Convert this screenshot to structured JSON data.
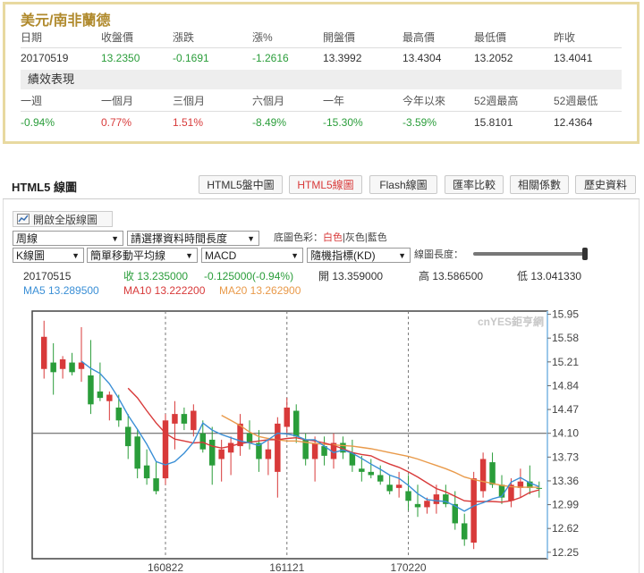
{
  "quote": {
    "title": "美元/南非蘭德",
    "headers": [
      "日期",
      "收盤價",
      "漲跌",
      "漲%",
      "開盤價",
      "最高價",
      "最低價",
      "昨收"
    ],
    "values": [
      "20170519",
      "13.2350",
      "-0.1691",
      "-1.2616",
      "13.3992",
      "13.4304",
      "13.2052",
      "13.4041"
    ],
    "perf_title": "績效表現",
    "perf_headers": [
      "一週",
      "一個月",
      "三個月",
      "六個月",
      "一年",
      "今年以來",
      "52週最高",
      "52週最低"
    ],
    "perf_values": [
      "-0.94%",
      "0.77%",
      "1.51%",
      "-8.49%",
      "-15.30%",
      "-3.59%",
      "15.8101",
      "12.4364"
    ]
  },
  "chart_panel": {
    "title": "HTML5 線圖",
    "tabs": [
      "HTML5盤中圖",
      "HTML5線圖",
      "Flash線圖",
      "匯率比較",
      "相關係數",
      "歷史資料"
    ],
    "active_tab": "HTML5線圖",
    "fullscreen_label": "開啟全版線圖",
    "period_select": "周線",
    "range_select": "請選擇資料時間長度",
    "bg_label": "底圖色彩：",
    "bg_white": "白色",
    "bg_sep1": "|",
    "bg_gray": "灰色",
    "bg_sep2": "|",
    "bg_blue": "藍色",
    "kline_select": "K線圖",
    "ma_select": "簡單移動平均線",
    "indicator_select": "MACD",
    "kd_select": "隨機指標(KD)",
    "length_label": "線圖長度："
  },
  "info": {
    "date": "20170515",
    "close": "收 13.235000",
    "change": "-0.125000(-0.94%)",
    "open": "開 13.359000",
    "high": "高 13.586500",
    "low": "低 13.041330",
    "ma5": "MA5 13.289500",
    "ma10": "MA10 13.222200",
    "ma20": "MA20 13.262900"
  },
  "colors": {
    "up": "#d83a3a",
    "down": "#2a9d3a",
    "ma5": "#3a8fd6",
    "ma10": "#d83a3a",
    "ma20": "#e99a4a",
    "accent": "#b08a2d"
  },
  "chart_data": {
    "type": "candlestick",
    "watermark": "cnYES鉅亨網",
    "ylim": [
      12.15,
      16.0
    ],
    "y_ticks": [
      15.95,
      15.58,
      15.21,
      14.84,
      14.47,
      14.1,
      13.73,
      13.36,
      12.99,
      12.62,
      12.25
    ],
    "y_tick_labels": [
      "15.95",
      "15.58",
      "15.21",
      "14.84",
      "14.47",
      "14.10",
      "13.73",
      "13.36",
      "12.99",
      "12.62",
      "12.25"
    ],
    "x_labels": [
      {
        "index": 13,
        "label": "160822"
      },
      {
        "index": 26,
        "label": "161121"
      },
      {
        "index": 39,
        "label": "170220"
      }
    ],
    "candles": [
      {
        "o": 15.1,
        "h": 15.85,
        "l": 14.95,
        "c": 15.6
      },
      {
        "o": 15.2,
        "h": 15.5,
        "l": 14.7,
        "c": 15.05
      },
      {
        "o": 15.1,
        "h": 15.3,
        "l": 14.95,
        "c": 15.25
      },
      {
        "o": 15.2,
        "h": 15.35,
        "l": 15.0,
        "c": 15.05
      },
      {
        "o": 15.1,
        "h": 15.75,
        "l": 14.9,
        "c": 15.2
      },
      {
        "o": 15.0,
        "h": 15.55,
        "l": 14.4,
        "c": 14.55
      },
      {
        "o": 14.75,
        "h": 15.2,
        "l": 14.6,
        "c": 14.65
      },
      {
        "o": 14.6,
        "h": 14.75,
        "l": 14.3,
        "c": 14.7
      },
      {
        "o": 14.5,
        "h": 14.7,
        "l": 14.2,
        "c": 14.3
      },
      {
        "o": 14.2,
        "h": 14.4,
        "l": 13.7,
        "c": 13.9
      },
      {
        "o": 14.05,
        "h": 14.15,
        "l": 13.4,
        "c": 13.55
      },
      {
        "o": 13.6,
        "h": 13.85,
        "l": 13.3,
        "c": 13.4
      },
      {
        "o": 13.4,
        "h": 13.65,
        "l": 13.15,
        "c": 13.2
      },
      {
        "o": 13.4,
        "h": 14.4,
        "l": 13.3,
        "c": 14.3
      },
      {
        "o": 14.25,
        "h": 14.6,
        "l": 13.85,
        "c": 14.4
      },
      {
        "o": 14.4,
        "h": 14.5,
        "l": 14.15,
        "c": 14.25
      },
      {
        "o": 14.15,
        "h": 14.55,
        "l": 14.05,
        "c": 14.45
      },
      {
        "o": 14.1,
        "h": 14.3,
        "l": 13.8,
        "c": 13.85
      },
      {
        "o": 14.0,
        "h": 14.2,
        "l": 13.3,
        "c": 13.6
      },
      {
        "o": 13.7,
        "h": 14.0,
        "l": 13.35,
        "c": 13.85
      },
      {
        "o": 13.8,
        "h": 14.05,
        "l": 13.45,
        "c": 13.95
      },
      {
        "o": 13.9,
        "h": 14.4,
        "l": 13.75,
        "c": 14.25
      },
      {
        "o": 14.1,
        "h": 14.3,
        "l": 13.85,
        "c": 13.95
      },
      {
        "o": 13.95,
        "h": 14.15,
        "l": 13.5,
        "c": 13.7
      },
      {
        "o": 13.7,
        "h": 14.0,
        "l": 13.45,
        "c": 13.85
      },
      {
        "o": 13.5,
        "h": 14.35,
        "l": 13.1,
        "c": 14.25
      },
      {
        "o": 14.2,
        "h": 14.65,
        "l": 14.1,
        "c": 14.5
      },
      {
        "o": 14.45,
        "h": 14.55,
        "l": 13.95,
        "c": 14.05
      },
      {
        "o": 14.0,
        "h": 14.1,
        "l": 13.6,
        "c": 13.7
      },
      {
        "o": 13.7,
        "h": 14.05,
        "l": 13.35,
        "c": 13.95
      },
      {
        "o": 13.9,
        "h": 14.05,
        "l": 13.6,
        "c": 13.75
      },
      {
        "o": 13.7,
        "h": 14.1,
        "l": 13.55,
        "c": 13.95
      },
      {
        "o": 13.95,
        "h": 14.05,
        "l": 13.7,
        "c": 13.8
      },
      {
        "o": 13.8,
        "h": 14.0,
        "l": 13.5,
        "c": 13.6
      },
      {
        "o": 13.55,
        "h": 13.75,
        "l": 13.35,
        "c": 13.5
      },
      {
        "o": 13.5,
        "h": 13.7,
        "l": 13.4,
        "c": 13.45
      },
      {
        "o": 13.45,
        "h": 13.6,
        "l": 13.3,
        "c": 13.35
      },
      {
        "o": 13.3,
        "h": 13.45,
        "l": 13.15,
        "c": 13.2
      },
      {
        "o": 13.25,
        "h": 13.5,
        "l": 13.1,
        "c": 13.3
      },
      {
        "o": 13.2,
        "h": 13.45,
        "l": 12.9,
        "c": 13.05
      },
      {
        "o": 13.0,
        "h": 13.3,
        "l": 12.8,
        "c": 12.95
      },
      {
        "o": 12.95,
        "h": 13.1,
        "l": 12.85,
        "c": 13.05
      },
      {
        "o": 13.0,
        "h": 13.3,
        "l": 12.85,
        "c": 13.15
      },
      {
        "o": 13.15,
        "h": 13.3,
        "l": 12.95,
        "c": 13.0
      },
      {
        "o": 13.0,
        "h": 13.2,
        "l": 12.6,
        "c": 12.7
      },
      {
        "o": 12.7,
        "h": 12.85,
        "l": 12.35,
        "c": 12.45
      },
      {
        "o": 12.4,
        "h": 13.5,
        "l": 12.3,
        "c": 13.4
      },
      {
        "o": 13.2,
        "h": 13.8,
        "l": 13.1,
        "c": 13.7
      },
      {
        "o": 13.65,
        "h": 13.8,
        "l": 13.25,
        "c": 13.3
      },
      {
        "o": 13.3,
        "h": 13.45,
        "l": 13.0,
        "c": 13.1
      },
      {
        "o": 13.05,
        "h": 13.4,
        "l": 12.95,
        "c": 13.3
      },
      {
        "o": 13.25,
        "h": 13.55,
        "l": 13.1,
        "c": 13.35
      },
      {
        "o": 13.35,
        "h": 13.6,
        "l": 13.15,
        "c": 13.25
      },
      {
        "o": 13.25,
        "h": 13.35,
        "l": 13.1,
        "c": 13.24
      }
    ],
    "ma5": [
      null,
      null,
      null,
      null,
      15.22,
      15.11,
      15.03,
      14.87,
      14.64,
      14.38,
      14.16,
      13.93,
      13.66,
      13.61,
      13.66,
      13.79,
      13.96,
      14.26,
      14.15,
      14.08,
      14.03,
      13.98,
      13.95,
      13.91,
      14.0,
      14.1,
      14.09,
      14.06,
      14.0,
      14.0,
      13.9,
      13.8,
      13.84,
      13.79,
      13.71,
      13.62,
      13.54,
      13.45,
      13.4,
      13.29,
      13.16,
      13.07,
      13.05,
      13.04,
      12.97,
      12.89,
      12.97,
      13.02,
      13.08,
      13.12,
      13.34,
      13.41,
      13.33,
      13.27
    ],
    "ma10": [
      null,
      null,
      null,
      null,
      null,
      null,
      null,
      null,
      null,
      14.8,
      14.65,
      14.45,
      14.26,
      14.1,
      14.01,
      13.98,
      13.95,
      13.96,
      13.9,
      13.87,
      13.9,
      13.94,
      13.96,
      13.98,
      14.0,
      14.0,
      14.02,
      14.03,
      14.0,
      13.98,
      13.95,
      13.91,
      13.86,
      13.8,
      13.77,
      13.75,
      13.68,
      13.62,
      13.57,
      13.5,
      13.42,
      13.33,
      13.24,
      13.19,
      13.12,
      13.05,
      13.04,
      13.04,
      13.04,
      13.03,
      13.05,
      13.1,
      13.18,
      13.22
    ],
    "ma20": [
      null,
      null,
      null,
      null,
      null,
      null,
      null,
      null,
      null,
      null,
      null,
      null,
      null,
      null,
      null,
      null,
      null,
      null,
      null,
      14.38,
      14.3,
      14.22,
      14.12,
      14.05,
      14.02,
      14.0,
      13.98,
      13.98,
      13.96,
      13.94,
      13.93,
      13.92,
      13.91,
      13.9,
      13.88,
      13.86,
      13.83,
      13.8,
      13.77,
      13.74,
      13.7,
      13.65,
      13.6,
      13.55,
      13.49,
      13.42,
      13.38,
      13.35,
      13.32,
      13.29,
      13.27,
      13.26,
      13.26,
      13.26
    ]
  }
}
